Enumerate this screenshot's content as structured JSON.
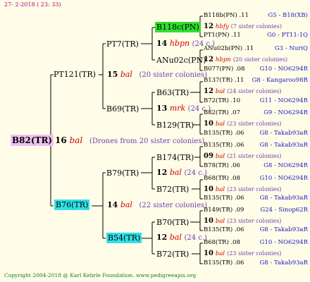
{
  "header": {
    "date": "27-  2-2018 ( 23: 33)"
  },
  "footer": {
    "copyright": "Copyright 2004-2018 @ Karl Kehrle Foundation.   www.pedigreeapis.org"
  },
  "root": {
    "label": "B82(TR)",
    "count": "16",
    "note": "bal",
    "desc": "(Drones from 20 sister colonies)"
  },
  "gen1": [
    {
      "label": "PT121(TR)",
      "count": "15",
      "note": "bal",
      "desc": "(20 sister colonies)"
    },
    {
      "label": "B76(TR)",
      "count": "14",
      "note": "bal",
      "desc": "(22 sister colonies)"
    }
  ],
  "gen2": [
    {
      "label": "PT7(TR)"
    },
    {
      "label": "B69(TR)",
      "count": "13",
      "note": "mrk",
      "desc": "(24 c.)"
    },
    {
      "label": "B79(TR)",
      "count": "12",
      "note": "bal",
      "desc": "(24 c.)"
    },
    {
      "label": "B54(TR)",
      "count": "12",
      "note": "bal",
      "desc": "(24 c.)"
    }
  ],
  "gen3": [
    {
      "label": "B118c(PN)",
      "count": "14",
      "note": "hbpn",
      "desc": "(24 c.)"
    },
    {
      "label": "ANu02c(PN)"
    },
    {
      "label": "B63(TR)"
    },
    {
      "label": "B129(TR)"
    },
    {
      "label": "B174(TR)"
    },
    {
      "label": "B72(TR)"
    },
    {
      "label": "B70(TR)"
    },
    {
      "label": "B72(TR)"
    }
  ],
  "gen4": [
    {
      "name": "B118b(PN) .11",
      "code": "G5 - B18(XB)"
    },
    {
      "count": "12",
      "note": "hbfy",
      "desc": "(7 sister colonies)"
    },
    {
      "name": "PT1(PN) .11",
      "code": "G0 - PT11-1Q"
    },
    {
      "name": "ANu02b(PN) .11",
      "code": "G3 - NuriQ"
    },
    {
      "count": "12",
      "note": "hbpn",
      "desc": "(20 sister colonies)"
    },
    {
      "name": "B077(PN) .08",
      "code": "G10 - NO6294R"
    },
    {
      "name": "B137(TR) .11",
      "code": "G8 - Kangaroo98R"
    },
    {
      "count": "12",
      "note": "bal",
      "desc": "(24 sister colonies)"
    },
    {
      "name": "B72(TR) .10",
      "code": "G11 - NO6294R"
    },
    {
      "name": "B82(TR) .07",
      "code": "G9 - NO6294R"
    },
    {
      "count": "10",
      "note": "bal",
      "desc": "(23 sister colonies)"
    },
    {
      "name": "B135(TR) .06",
      "code": "G8 - Takab93aR"
    },
    {
      "name": "B135(TR) .06",
      "code": "G8 - Takab93aR"
    },
    {
      "count": "09",
      "note": "bal",
      "desc": "(21 sister colonies)"
    },
    {
      "name": "B78(TR) .06",
      "code": "G8 - NO6294R"
    },
    {
      "name": "B68(TR) .08",
      "code": "G10 - NO6294R"
    },
    {
      "count": "10",
      "note": "bal",
      "desc": "(23 sister colonies)"
    },
    {
      "name": "B135(TR) .06",
      "code": "G8 - Takab93aR"
    },
    {
      "name": "B149(TR) .09",
      "code": "G24 - Sinop62R"
    },
    {
      "count": "10",
      "note": "bal",
      "desc": "(23 sister colonies)"
    },
    {
      "name": "B135(TR) .06",
      "code": "G8 - Takab93aR"
    },
    {
      "name": "B68(TR) .08",
      "code": "G10 - NO6294R"
    },
    {
      "count": "10",
      "note": "bal",
      "desc": "(23 sister colonies)"
    },
    {
      "name": "B135(TR) .06",
      "code": "G8 - Takab93aR"
    }
  ]
}
